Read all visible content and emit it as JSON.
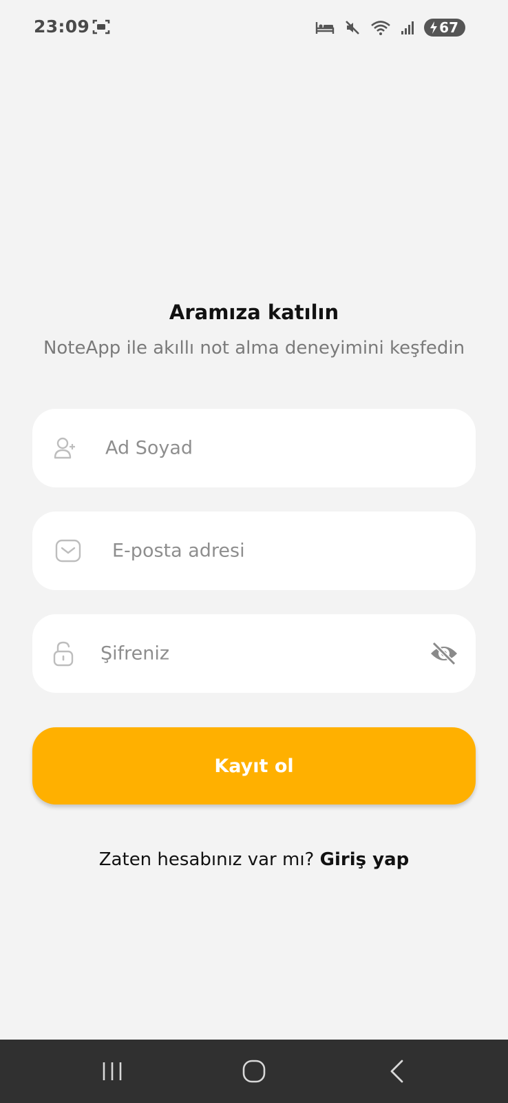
{
  "status_bar": {
    "time": "23:09",
    "battery": "67",
    "icons": [
      "screenshot-icon",
      "sleep-mode-icon",
      "mute-icon",
      "wifi-icon",
      "signal-icon",
      "battery-charging-icon"
    ]
  },
  "signup": {
    "title": "Aramıza katılın",
    "subtitle": "NoteApp ile akıllı not alma deneyimini keşfedin",
    "name_placeholder": "Ad Soyad",
    "email_placeholder": "E-posta adresi",
    "password_placeholder": "Şifreniz",
    "register_label": "Kayıt ol",
    "login_prompt": "Zaten hesabınız var mı?",
    "login_link": "Giriş yap"
  },
  "navigation": {
    "buttons": [
      "recent-apps-icon",
      "home-icon",
      "back-icon"
    ]
  },
  "colors": {
    "accent": "#ffb000",
    "background": "#f3f3f3",
    "field_background": "#ffffff",
    "nav_background": "#303030"
  }
}
